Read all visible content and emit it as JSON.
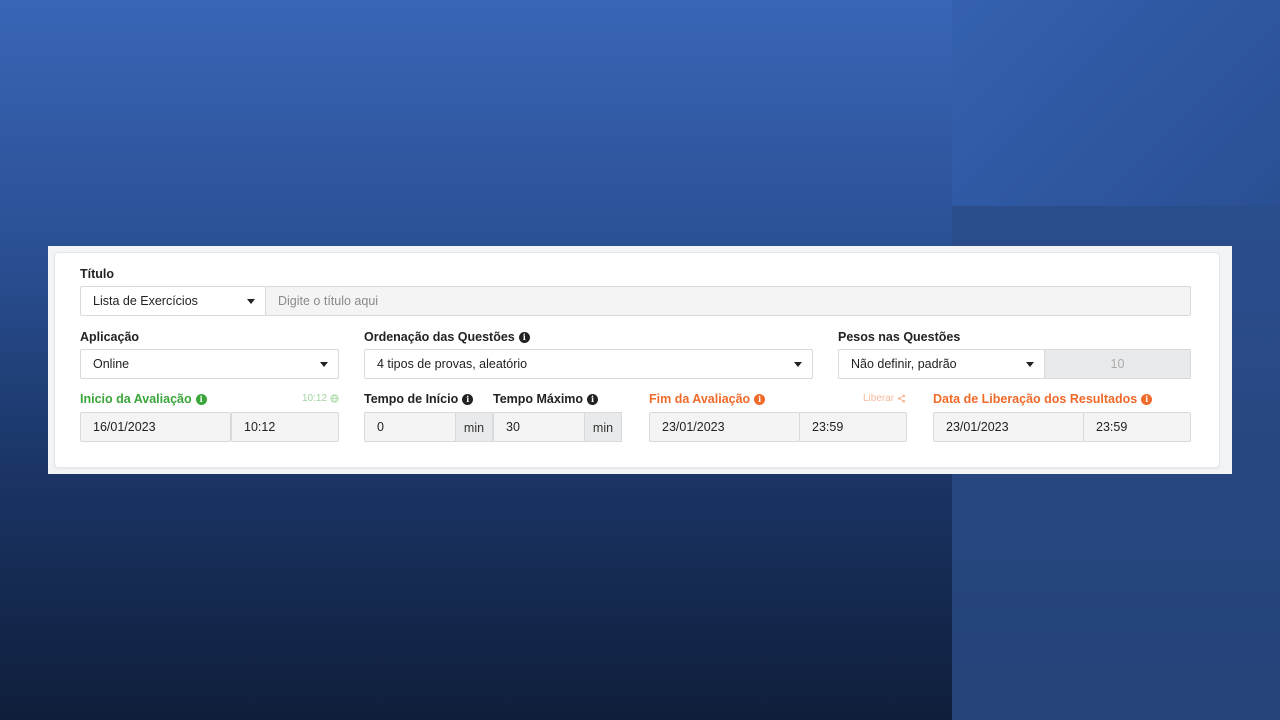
{
  "titulo": {
    "label": "Título",
    "type_value": "Lista de Exercícios",
    "placeholder": "Digite o título aqui"
  },
  "aplicacao": {
    "label": "Aplicação",
    "value": "Online"
  },
  "ordenacao": {
    "label": "Ordenação das Questões",
    "value": "4 tipos de provas, aleatório"
  },
  "pesos": {
    "label": "Pesos nas Questões",
    "value": "Não definir, padrão",
    "weight_value": "10"
  },
  "inicio": {
    "label": "Inicio da Avaliação",
    "now_link": "10:12",
    "date": "16/01/2023",
    "time": "10:12"
  },
  "tempo_inicio": {
    "label": "Tempo de Início",
    "value": "0",
    "unit": "min"
  },
  "tempo_maximo": {
    "label": "Tempo Máximo",
    "value": "30",
    "unit": "min"
  },
  "fim": {
    "label": "Fim da Avaliação",
    "release_link": "Liberar",
    "date": "23/01/2023",
    "time": "23:59"
  },
  "liberacao": {
    "label": "Data de Liberação dos Resultados",
    "date": "23/01/2023",
    "time": "23:59"
  },
  "colors": {
    "green": "#3aa63a",
    "orange": "#f06a2a"
  }
}
